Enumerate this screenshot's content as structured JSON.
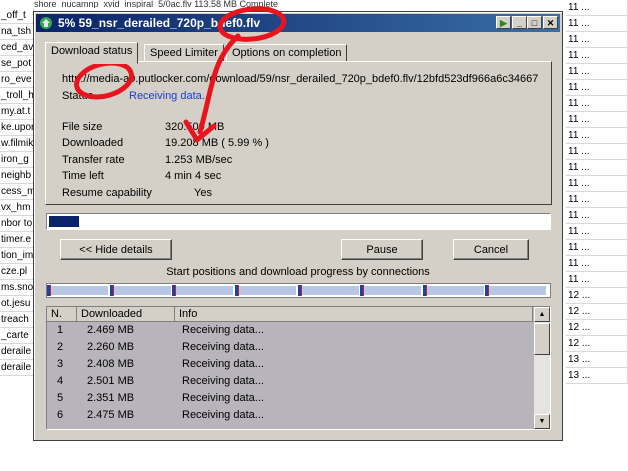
{
  "background": {
    "top_strip": "shore_nucamnp_xvid_inspiral_5/0ac.flv        113.58  MB        Complete",
    "left_col": [
      "_off_t",
      "na_tsh",
      "ced_av",
      "se_pot",
      "ro_eve",
      "_troll_h",
      "my.at.t",
      "ke.upon",
      "w.filmik",
      "iron_g",
      "neighb",
      "cess_m",
      "vx_hm",
      "nbor to",
      "timer.e",
      "tion_imp",
      "cze.pl",
      "ms.sno",
      "ot.jesu",
      "treach",
      "_carte",
      "deraile",
      "deraile"
    ],
    "right_col": [
      "11 ...",
      "11 ...",
      "11 ...",
      "11 ...",
      "11 ...",
      "11 ...",
      "11 ...",
      "11 ...",
      "11 ...",
      "11 ...",
      "11 ...",
      "11 ...",
      "11 ...",
      "11 ...",
      "11 ...",
      "11 ...",
      "11 ...",
      "11 ...",
      "12 ...",
      "12 ...",
      "12 ...",
      "12 ...",
      "13 ...",
      "13 ..."
    ]
  },
  "window": {
    "title": "5% 59_nsr_derailed_720p_bdef0.flv",
    "controls": {
      "pin": "▶",
      "minimize": "_",
      "maximize": "□",
      "close": "✕"
    }
  },
  "tabs": [
    "Download status",
    "Speed Limiter",
    "Options on completion"
  ],
  "panel": {
    "url": "http://media-a9.putlocker.com/download/59/nsr_derailed_720p_bdef0.flv/12bfd523df966a6c34667",
    "status_label": "Status",
    "status_value": "Receiving data...",
    "rows": [
      {
        "label": "File size",
        "value": "320.500  MB"
      },
      {
        "label": "Downloaded",
        "value": "19.208  MB  ( 5.99 % )"
      },
      {
        "label": "Transfer rate",
        "value": "1.253  MB/sec"
      },
      {
        "label": "Time left",
        "value": "4 min 4 sec"
      },
      {
        "label": "Resume capability",
        "value": "Yes"
      }
    ]
  },
  "progress_fraction": 0.0599,
  "buttons": {
    "hide_details": "<< Hide details",
    "pause": "Pause",
    "cancel": "Cancel"
  },
  "connections": {
    "title": "Start positions and download progress by connections",
    "columns": [
      "N.",
      "Downloaded",
      "Info"
    ],
    "rows": [
      {
        "n": "1",
        "downloaded": "2.469  MB",
        "info": "Receiving data..."
      },
      {
        "n": "2",
        "downloaded": "2.260  MB",
        "info": "Receiving data..."
      },
      {
        "n": "3",
        "downloaded": "2.408  MB",
        "info": "Receiving data..."
      },
      {
        "n": "4",
        "downloaded": "2.501  MB",
        "info": "Receiving data..."
      },
      {
        "n": "5",
        "downloaded": "2.351  MB",
        "info": "Receiving data..."
      },
      {
        "n": "6",
        "downloaded": "2.475  MB",
        "info": "Receiving data..."
      }
    ]
  },
  "colors": {
    "title_bar": "#0a246a",
    "annotation": "#e8141e",
    "link_status": "#1a3ccc"
  }
}
